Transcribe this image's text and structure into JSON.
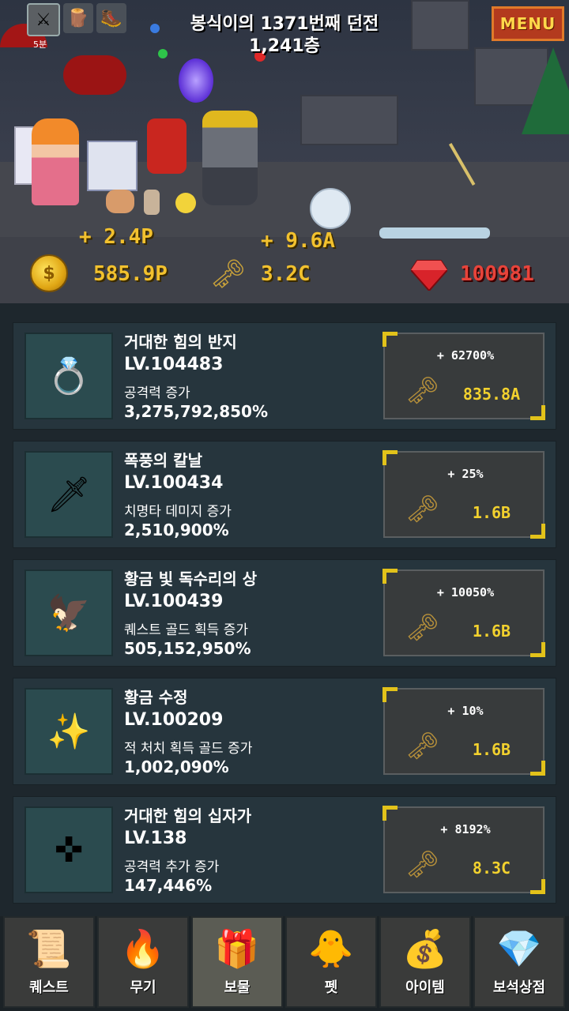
{
  "header": {
    "dungeon_title": "봉식이의 1371번째 던전",
    "floor": "1,241층",
    "menu_label": "MENU",
    "tab_badge": "5분"
  },
  "stats": {
    "gold_rate": "+ 2.4P",
    "gold": "585.9P",
    "key_rate": "+ 9.6A",
    "keys": "3.2C",
    "gems": "100981"
  },
  "colors": {
    "accent_gold": "#f2c12e",
    "gem_red": "#e8433a",
    "menu_bg": "#b33a1e"
  },
  "treasures": [
    {
      "icon": "ring-icon",
      "glyph": "💍",
      "name": "거대한 힘의 반지",
      "level": "LV.104483",
      "desc": "공격력 증가",
      "value": "3,275,792,850%",
      "pct": "+ 62700%",
      "cost": "835.8A"
    },
    {
      "icon": "storm-blade-icon",
      "glyph": "🗡",
      "name": "폭풍의 칼날",
      "level": "LV.100434",
      "desc": "치명타 데미지 증가",
      "value": "2,510,900%",
      "pct": "+ 25%",
      "cost": "1.6B"
    },
    {
      "icon": "golden-eagle-icon",
      "glyph": "🦅",
      "name": "황금 빛 독수리의 상",
      "level": "LV.100439",
      "desc": "퀘스트 골드 획득 증가",
      "value": "505,152,950%",
      "pct": "+ 10050%",
      "cost": "1.6B"
    },
    {
      "icon": "gold-crystal-icon",
      "glyph": "✨",
      "name": "황금 수정",
      "level": "LV.100209",
      "desc": "적 처치 획득 골드 증가",
      "value": "1,002,090%",
      "pct": "+ 10%",
      "cost": "1.6B"
    },
    {
      "icon": "cross-icon",
      "glyph": "✜",
      "name": "거대한 힘의 십자가",
      "level": "LV.138",
      "desc": "공격력 추가 증가",
      "value": "147,446%",
      "pct": "+ 8192%",
      "cost": "8.3C"
    }
  ],
  "nav": [
    {
      "icon": "scroll-icon",
      "glyph": "📜",
      "label": "퀘스트",
      "active": false
    },
    {
      "icon": "weapon-icon",
      "glyph": "🔥",
      "label": "무기",
      "active": false
    },
    {
      "icon": "treasure-chest-icon",
      "glyph": "🎁",
      "label": "보물",
      "active": true
    },
    {
      "icon": "chick-icon",
      "glyph": "🐥",
      "label": "펫",
      "active": false
    },
    {
      "icon": "item-bag-icon",
      "glyph": "💰",
      "label": "아이템",
      "active": false
    },
    {
      "icon": "gem-shop-icon",
      "glyph": "💎",
      "label": "보석상점",
      "active": false
    }
  ]
}
